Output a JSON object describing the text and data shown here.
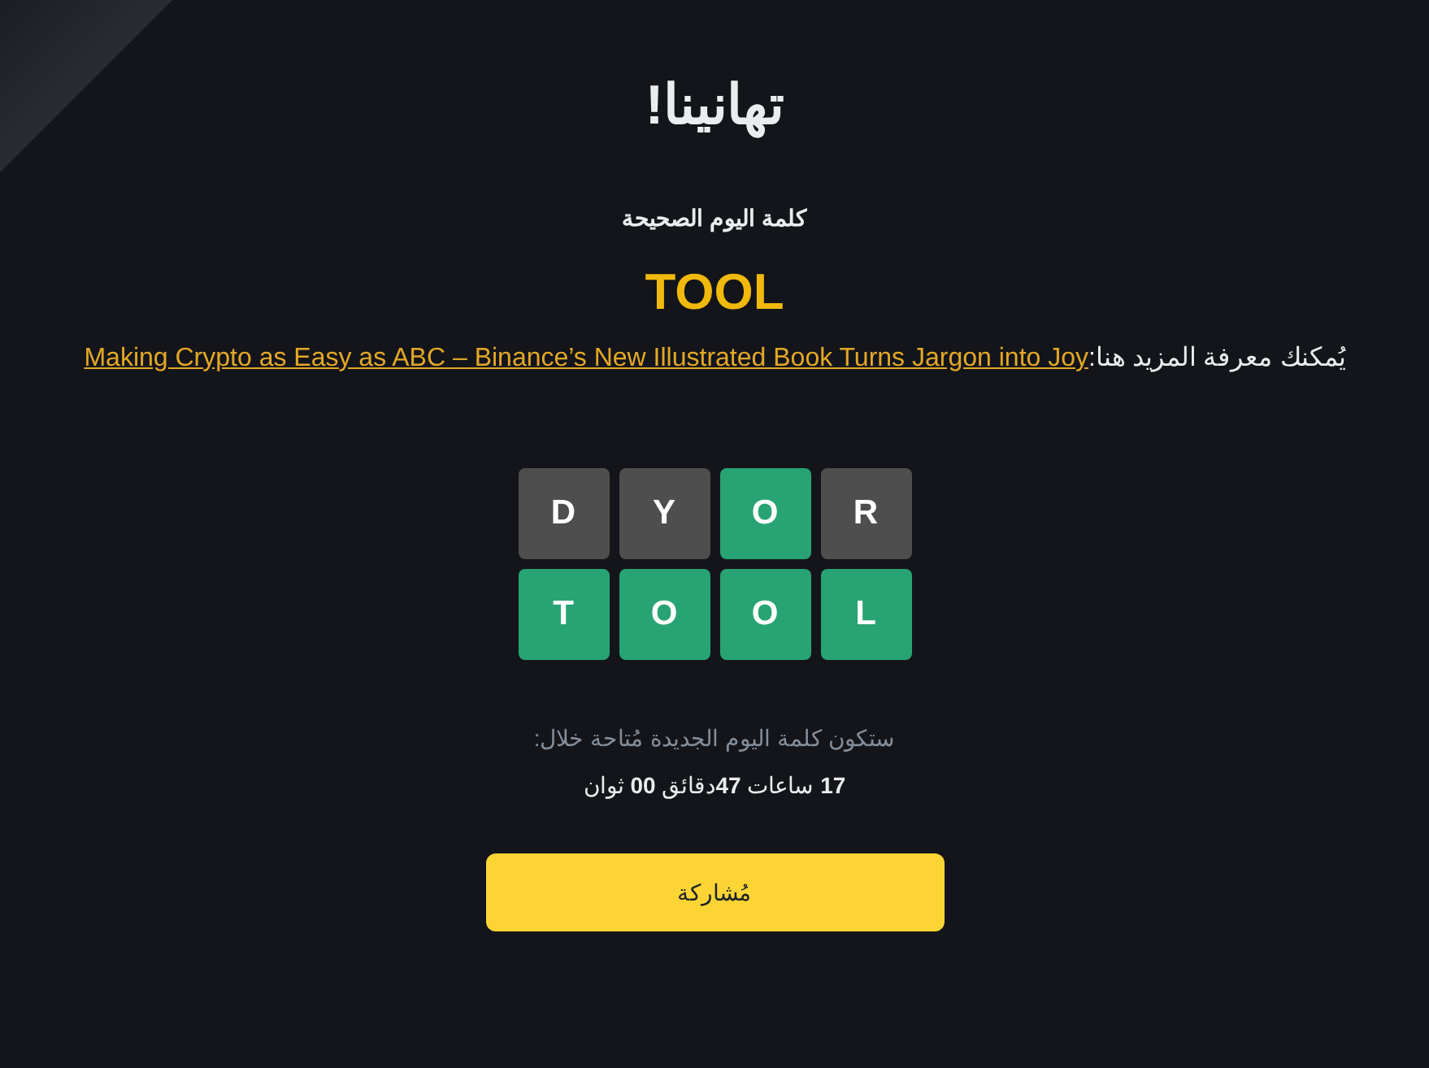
{
  "title": "تهانينا!",
  "answer_label": "كلمة اليوم الصحيحة",
  "answer": "TOOL",
  "learn_more": {
    "label": "يُمكنك معرفة المزيد هنا:",
    "link": "Making Crypto as Easy as ABC – Binance’s New Illustrated Book Turns Jargon into Joy"
  },
  "guesses": [
    {
      "tiles": [
        {
          "letter": "R",
          "color": "#4e4e4e"
        },
        {
          "letter": "O",
          "color": "#28a474"
        },
        {
          "letter": "Y",
          "color": "#4e4e4e"
        },
        {
          "letter": "D",
          "color": "#4e4e4e"
        }
      ]
    },
    {
      "tiles": [
        {
          "letter": "L",
          "color": "#28a474"
        },
        {
          "letter": "O",
          "color": "#28a474"
        },
        {
          "letter": "O",
          "color": "#28a474"
        },
        {
          "letter": "T",
          "color": "#28a474"
        }
      ]
    }
  ],
  "next_word": {
    "label": "ستكون كلمة اليوم الجديدة مُتاحة خلال:",
    "countdown": "**17** ساعات **47**دقائق **00** ثوان"
  },
  "share_button": "مُشاركة"
}
